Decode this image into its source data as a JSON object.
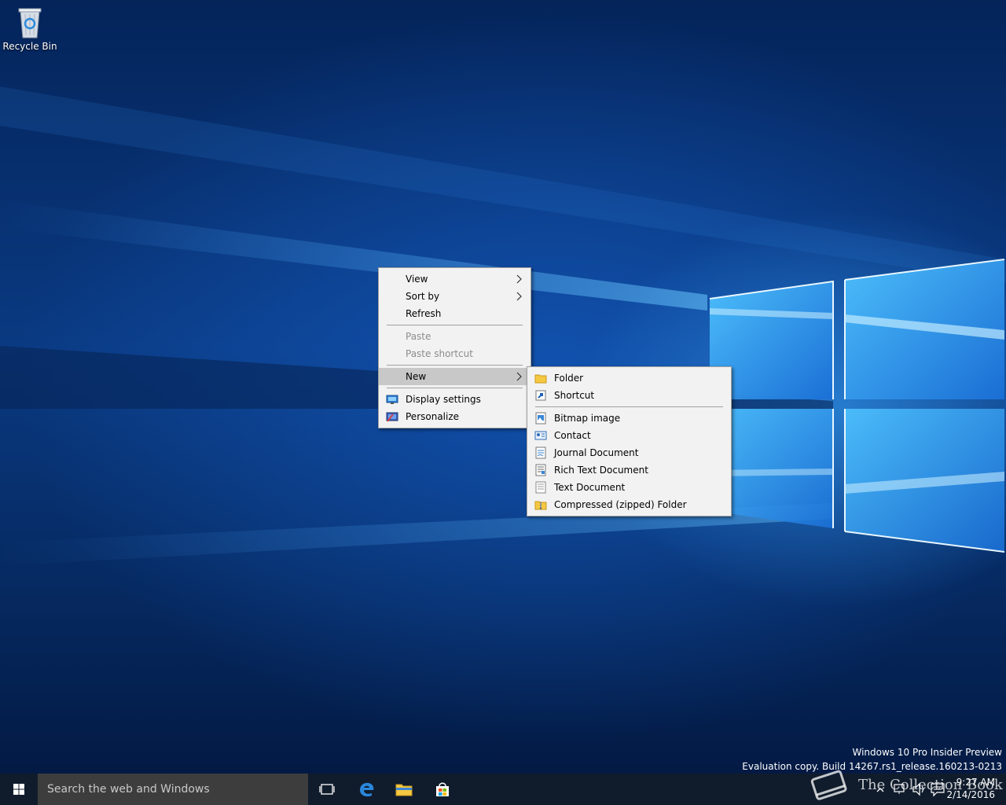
{
  "desktop": {
    "icons": [
      {
        "label": "Recycle Bin",
        "icon": "recycle-bin-icon"
      }
    ]
  },
  "context_menu": {
    "items": [
      {
        "label": "View",
        "submenu": true
      },
      {
        "label": "Sort by",
        "submenu": true
      },
      {
        "label": "Refresh"
      },
      {
        "label": "Paste",
        "disabled": true
      },
      {
        "label": "Paste shortcut",
        "disabled": true
      },
      {
        "label": "New",
        "submenu": true,
        "active": true
      },
      {
        "label": "Display settings",
        "icon": "display-settings-icon"
      },
      {
        "label": "Personalize",
        "icon": "personalize-icon"
      }
    ]
  },
  "new_submenu": {
    "items": [
      {
        "label": "Folder",
        "icon": "folder-icon"
      },
      {
        "label": "Shortcut",
        "icon": "shortcut-icon"
      },
      {
        "label": "Bitmap image",
        "icon": "bitmap-image-icon"
      },
      {
        "label": "Contact",
        "icon": "contact-icon"
      },
      {
        "label": "Journal Document",
        "icon": "journal-document-icon"
      },
      {
        "label": "Rich Text Document",
        "icon": "rich-text-document-icon"
      },
      {
        "label": "Text Document",
        "icon": "text-document-icon"
      },
      {
        "label": "Compressed (zipped) Folder",
        "icon": "zipped-folder-icon"
      }
    ]
  },
  "watermark": {
    "line1": "Windows 10 Pro Insider Preview",
    "line2": "Evaluation copy. Build 14267.rs1_release.160213-0213"
  },
  "taskbar": {
    "search_placeholder": "Search the web and Windows",
    "pinned": [
      "task-view-icon",
      "edge-icon",
      "file-explorer-icon",
      "store-icon"
    ],
    "clock_time": "9:27 AM",
    "clock_date": "2/14/2016",
    "overlay_text": "The Collection Book"
  },
  "colors": {
    "menu_bg": "#f2f2f2",
    "menu_active": "#c8c8c8",
    "taskbar_bg": "#101c2c",
    "search_bg": "#3d3d3d"
  }
}
